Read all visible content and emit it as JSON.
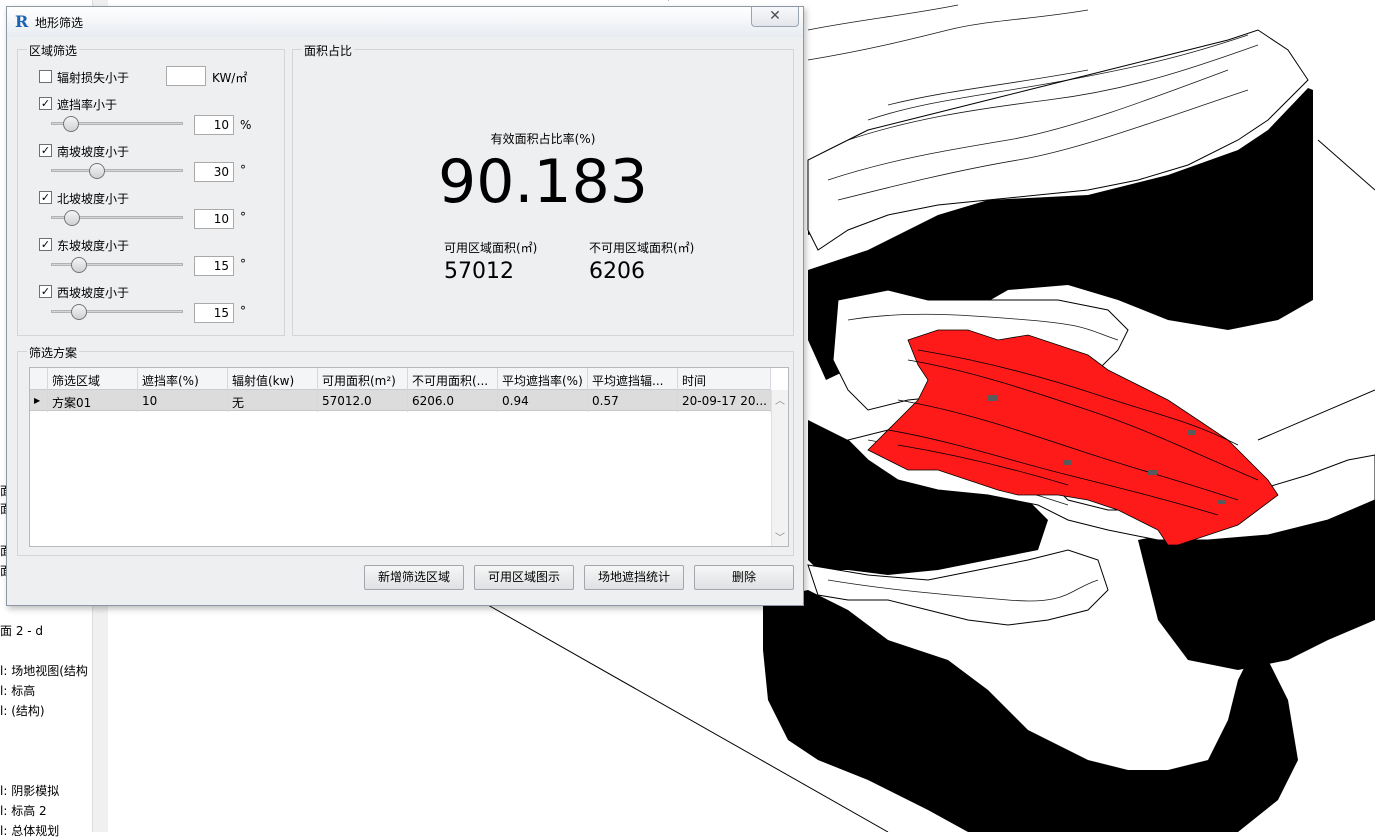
{
  "browser": {
    "items": [
      "面 2 - d",
      "l: 场地视图(结构",
      "l: 标高",
      "l: (结构)",
      "l: 阴影模拟",
      "l: 标高 2",
      "l: 总体规划"
    ],
    "fragments": [
      "面",
      "面",
      "面",
      "面"
    ]
  },
  "dialog": {
    "title": "地形筛选",
    "close_icon": "close-icon",
    "region_filter": {
      "legend": "区域筛选",
      "radiation": {
        "label": "辐射损失小于",
        "checked": false,
        "value": "",
        "unit": "KW/㎡"
      },
      "shading": {
        "label": "遮挡率小于",
        "checked": true,
        "value": "10",
        "unit": "%",
        "level": 0.1
      },
      "south": {
        "label": "南坡坡度小于",
        "checked": true,
        "value": "30",
        "unit": "°",
        "level": 0.33
      },
      "north": {
        "label": "北坡坡度小于",
        "checked": true,
        "value": "10",
        "unit": "°",
        "level": 0.11
      },
      "east": {
        "label": "东坡坡度小于",
        "checked": true,
        "value": "15",
        "unit": "°",
        "level": 0.17
      },
      "west": {
        "label": "西坡坡度小于",
        "checked": true,
        "value": "15",
        "unit": "°",
        "level": 0.17
      }
    },
    "area_ratio": {
      "legend": "面积占比",
      "ratio_caption": "有效面积占比率(%)",
      "ratio_value": "90.183",
      "usable_label": "可用区域面积(㎡)",
      "usable_value": "57012",
      "unusable_label": "不可用区域面积(㎡)",
      "unusable_value": "6206"
    },
    "scheme": {
      "legend": "筛选方案",
      "columns": [
        "筛选区域",
        "遮挡率(%)",
        "辐射值(kw)",
        "可用面积(m²)",
        "不可用面积(...",
        "平均遮挡率(%)",
        "平均遮挡辐...",
        "时间"
      ],
      "rows": [
        [
          "方案01",
          "10",
          "无",
          "57012.0",
          "6206.0",
          "0.94",
          "0.57",
          "20-09-17 20..."
        ]
      ]
    },
    "buttons": {
      "add_region": "新增筛选区域",
      "show_usable": "可用区域图示",
      "shading_stats": "场地遮挡统计",
      "delete": "删除"
    }
  },
  "colors": {
    "highlight": "#ff1a1a",
    "terrain_dark": "#000000",
    "selection": "#dcdcdc"
  }
}
